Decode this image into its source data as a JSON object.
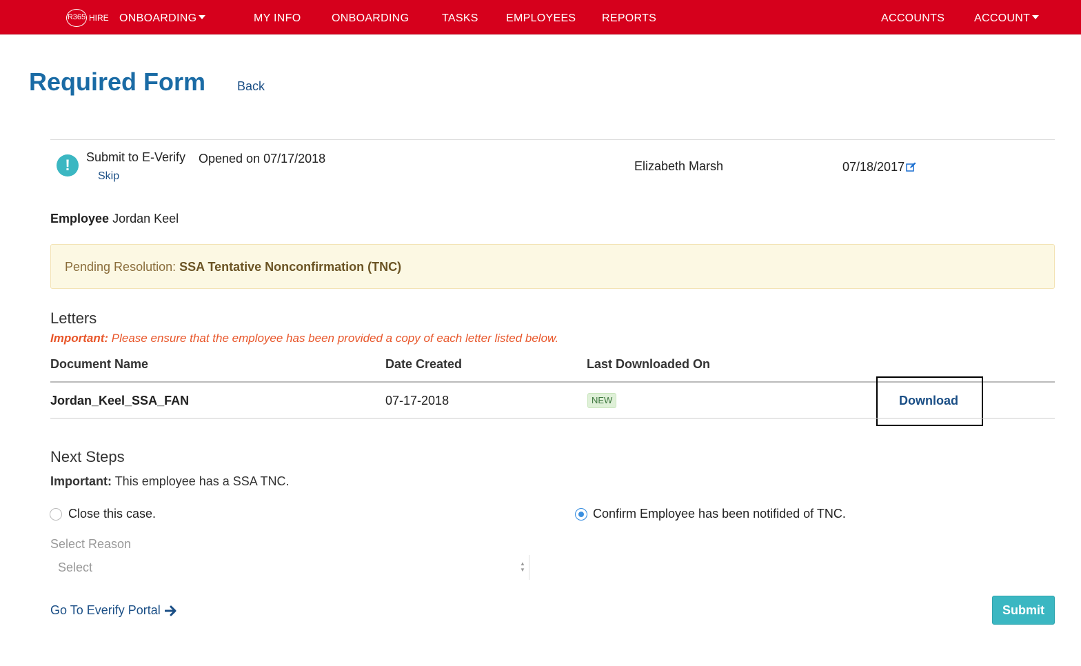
{
  "nav": {
    "logo_mark": "R365",
    "logo_text": "HIRE",
    "items": [
      {
        "label": "ONBOARDING",
        "dropdown": true
      },
      {
        "label": "MY INFO"
      },
      {
        "label": "ONBOARDING"
      },
      {
        "label": "TASKS"
      },
      {
        "label": "EMPLOYEES"
      },
      {
        "label": "REPORTS"
      },
      {
        "label": "ACCOUNTS"
      },
      {
        "label": "ACCOUNT",
        "dropdown": true
      }
    ],
    "bg_color": "#d6001c"
  },
  "header": {
    "title": "Required Form",
    "back_label": "Back"
  },
  "task": {
    "icon": "exclamation-circle-icon",
    "name": "Submit to E-Verify",
    "skip_label": "Skip",
    "opened": "Opened on 07/17/2018",
    "assignee": "Elizabeth Marsh",
    "due_date": "07/18/2017"
  },
  "employee": {
    "label": "Employee",
    "name": "Jordan Keel"
  },
  "pending": {
    "label": "Pending Resolution:",
    "value": "SSA Tentative Nonconfirmation (TNC)"
  },
  "letters": {
    "title": "Letters",
    "important_label": "Important:",
    "important_text": "Please ensure that the employee has been provided a copy of each letter listed below.",
    "columns": [
      "Document Name",
      "Date Created",
      "Last Downloaded On"
    ],
    "rows": [
      {
        "document_name": "Jordan_Keel_SSA_FAN",
        "date_created": "07-17-2018",
        "last_downloaded": "NEW",
        "action": "Download"
      }
    ]
  },
  "next_steps": {
    "title": "Next Steps",
    "important_label": "Important:",
    "important_text": "This employee has a SSA TNC.",
    "options": [
      {
        "label": "Close this case.",
        "checked": false
      },
      {
        "label": "Confirm Employee has been notifided of TNC.",
        "checked": true
      }
    ],
    "select_label": "Select Reason",
    "select_placeholder": "Select"
  },
  "footer": {
    "portal_link": "Go To Everify Portal",
    "submit_label": "Submit"
  },
  "colors": {
    "brand_red": "#d6001c",
    "title_blue": "#1a6ba5",
    "link_blue": "#1b4f86",
    "accent_teal": "#3bb7c2",
    "warning_orange": "#e8562a"
  }
}
